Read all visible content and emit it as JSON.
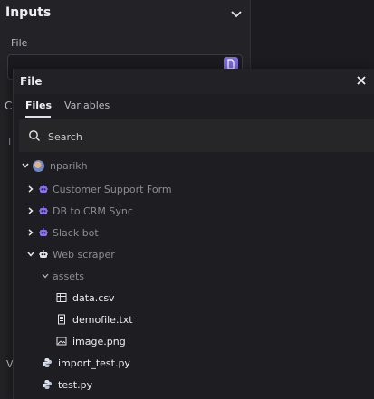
{
  "background": {
    "title": "Inputs",
    "field_label": "File",
    "fragment_c": "C",
    "fragment_i": "I",
    "fragment_v": "V"
  },
  "modal": {
    "title": "File",
    "tabs": [
      {
        "label": "Files",
        "active": true
      },
      {
        "label": "Variables",
        "active": false
      }
    ],
    "search_placeholder": "Search",
    "tree": {
      "user": "nparikh",
      "items": [
        {
          "label": "Customer Support Form",
          "icon": "bot-icon",
          "expanded": false
        },
        {
          "label": "DB to CRM Sync",
          "icon": "bot-icon",
          "expanded": false
        },
        {
          "label": "Slack bot",
          "icon": "bot-icon",
          "expanded": false
        },
        {
          "label": "Web scraper",
          "icon": "bot-icon",
          "expanded": true
        },
        {
          "label": "assets",
          "icon": "",
          "expanded": true
        },
        {
          "label": "data.csv",
          "icon": "table-icon"
        },
        {
          "label": "demofile.txt",
          "icon": "text-file-icon"
        },
        {
          "label": "image.png",
          "icon": "image-icon"
        },
        {
          "label": "import_test.py",
          "icon": "python-icon"
        },
        {
          "label": "test.py",
          "icon": "python-icon"
        }
      ]
    }
  },
  "colors": {
    "accent": "#7b6bd8",
    "bot_purple": "#8a6ff0",
    "python_blue": "#cfd6e6"
  }
}
